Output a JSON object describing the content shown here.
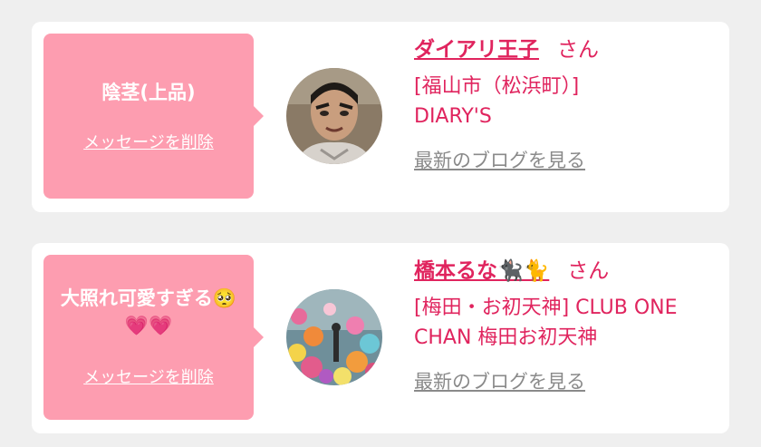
{
  "cards": [
    {
      "message": "陰茎(上品)",
      "delete_label": "メッセージを削除",
      "name": "ダイアリ王子",
      "honorific": "さん",
      "shop": "[福山市（松浜町）] DIARY'S",
      "blog_link": "最新のブログを見る",
      "avatar_icon": "avatar-photo-man-icon"
    },
    {
      "message": "大照れ可愛すぎる🥺💗💗",
      "delete_label": "メッセージを削除",
      "name": "橋本るな🐈‍⬛🐈",
      "honorific": "さん",
      "shop": "[梅田・お初天神] CLUB ONE CHAN 梅田お初天神",
      "blog_link": "最新のブログを見る",
      "avatar_icon": "avatar-photo-flowers-icon"
    }
  ],
  "colors": {
    "bubble": "#fd9db0",
    "accent": "#e0245e",
    "link_gray": "#8a8a8a",
    "background": "#efefef"
  }
}
